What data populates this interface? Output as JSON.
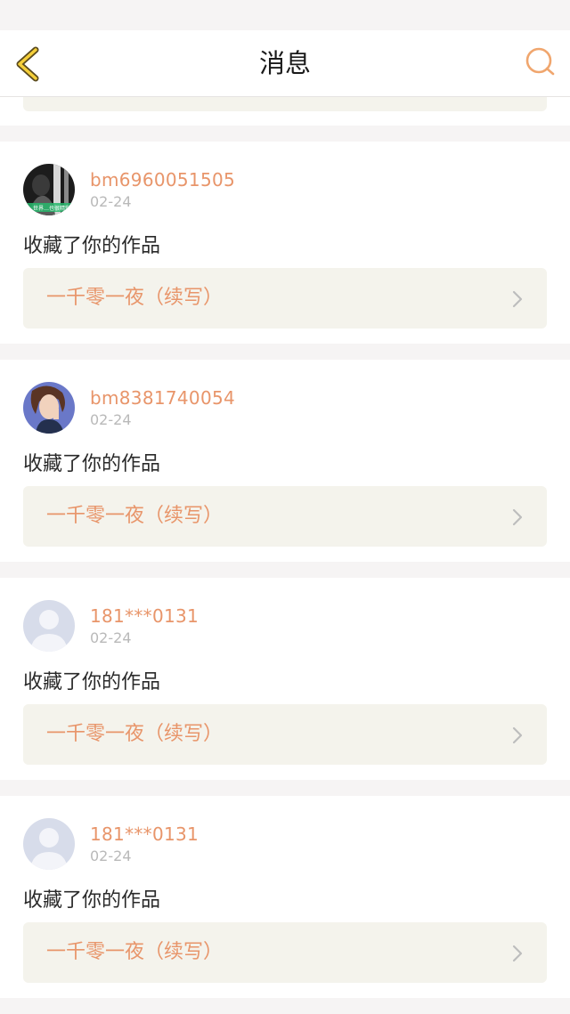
{
  "header": {
    "title": "消息",
    "back_icon": "chevron-left-icon",
    "search_icon": "search-icon",
    "accent": "#f0a66e"
  },
  "notifications": [
    {
      "username": "bm6960051505",
      "date": "02-24",
      "action": "收藏了你的作品",
      "work_title": "一千零一夜（续写）",
      "avatar": "photo-avatar",
      "avatar_badge": "…世界…也很精彩"
    },
    {
      "username": "bm8381740054",
      "date": "02-24",
      "action": "收藏了你的作品",
      "work_title": "一千零一夜（续写）",
      "avatar": "illustrated-avatar"
    },
    {
      "username": "181***0131",
      "date": "02-24",
      "action": "收藏了你的作品",
      "work_title": "一千零一夜（续写）",
      "avatar": "default-avatar"
    },
    {
      "username": "181***0131",
      "date": "02-24",
      "action": "收藏了你的作品",
      "work_title": "一千零一夜（续写）",
      "avatar": "default-avatar"
    }
  ],
  "colors": {
    "username": "#e8956a",
    "link_bg": "#f4f3ec",
    "page_bg": "#f6f4f4"
  }
}
